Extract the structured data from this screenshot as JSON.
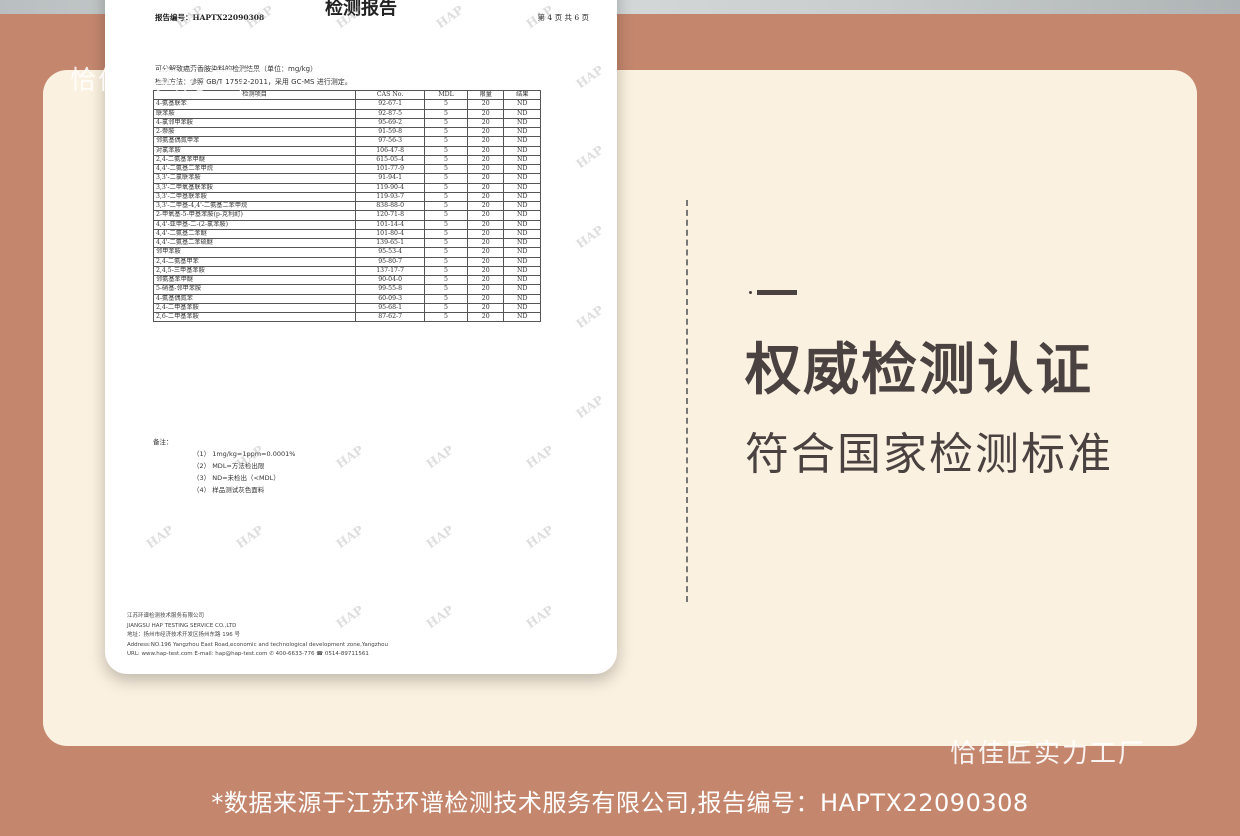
{
  "watermarks": {
    "top_left": "恰佳匠实力工厂",
    "bottom_right": "恰佳匠实力工厂"
  },
  "report": {
    "title": "检测报告",
    "report_no": "报告编号：HAPTX22090308",
    "page": "第 4 页 共 6 页",
    "subtitle1": "可分解致癌芳香胺染料的检测结果（单位：mg/kg）",
    "subtitle2": "检测方法：参照 GB/T 17592-2011，采用 GC-MS 进行测定。",
    "headers": [
      "检测项目",
      "CAS No.",
      "MDL",
      "限量",
      "结果"
    ],
    "rows": [
      [
        "4-氨基联苯",
        "92-67-1",
        "5",
        "20",
        "ND"
      ],
      [
        "联苯胺",
        "92-87-5",
        "5",
        "20",
        "ND"
      ],
      [
        "4-氯邻甲苯胺",
        "95-69-2",
        "5",
        "20",
        "ND"
      ],
      [
        "2-萘胺",
        "91-59-8",
        "5",
        "20",
        "ND"
      ],
      [
        "邻氨基偶氮甲苯",
        "97-56-3",
        "5",
        "20",
        "ND"
      ],
      [
        "对氯苯胺",
        "106-47-8",
        "5",
        "20",
        "ND"
      ],
      [
        "2,4-二氨基苯甲醚",
        "615-05-4",
        "5",
        "20",
        "ND"
      ],
      [
        "4,4'-二氨基二苯甲烷",
        "101-77-9",
        "5",
        "20",
        "ND"
      ],
      [
        "3,3'-二氯联苯胺",
        "91-94-1",
        "5",
        "20",
        "ND"
      ],
      [
        "3,3'-二甲氧基联苯胺",
        "119-90-4",
        "5",
        "20",
        "ND"
      ],
      [
        "3,3'-二甲基联苯胺",
        "119-93-7",
        "5",
        "20",
        "ND"
      ],
      [
        "3,3'-二甲基-4,4'-二氨基二苯甲烷",
        "838-88-0",
        "5",
        "20",
        "ND"
      ],
      [
        "2-甲氧基-5-甲基苯胺(p-克利酊)",
        "120-71-8",
        "5",
        "20",
        "ND"
      ],
      [
        "4,4'-亚甲基-二-(2-氯苯胺)",
        "101-14-4",
        "5",
        "20",
        "ND"
      ],
      [
        "4,4'-二氨基二苯醚",
        "101-80-4",
        "5",
        "20",
        "ND"
      ],
      [
        "4,4'-二氨基二苯硫醚",
        "139-65-1",
        "5",
        "20",
        "ND"
      ],
      [
        "邻甲苯胺",
        "95-53-4",
        "5",
        "20",
        "ND"
      ],
      [
        "2,4-二氨基甲苯",
        "95-80-7",
        "5",
        "20",
        "ND"
      ],
      [
        "2,4,5-三甲基苯胺",
        "137-17-7",
        "5",
        "20",
        "ND"
      ],
      [
        "邻氨基苯甲醚",
        "90-04-0",
        "5",
        "20",
        "ND"
      ],
      [
        "5-硝基-邻甲苯胺",
        "99-55-8",
        "5",
        "20",
        "ND"
      ],
      [
        "4-氨基偶氮苯",
        "60-09-3",
        "5",
        "20",
        "ND"
      ],
      [
        "2,4-二甲基苯胺",
        "95-68-1",
        "5",
        "20",
        "ND"
      ],
      [
        "2,6-二甲基苯胺",
        "87-62-7",
        "5",
        "20",
        "ND"
      ]
    ],
    "notes_label": "备注：",
    "notes": [
      "（1） 1mg/kg=1ppm=0.0001%",
      "（2） MDL=方法检出限",
      "（3） ND=未检出（<MDL）",
      "（4） 样品测试灰色面料"
    ],
    "footer": [
      "江苏环谱检测技术服务有限公司",
      "JIANGSU HAP TESTING SERVICE CO.,LTD",
      "地址：扬州市经济技术开发区扬州东路 196 号",
      "Address:NO.196 Yangzhou East Road,economic and technological development zone,Yangzhou",
      "URL: www.hap-test.com        E-mail: hap@hap-test.com        ✆ 400-6633-776    ☎ 0514-89711561"
    ],
    "watermark_text": "HAP"
  },
  "headline": {
    "dash": "—",
    "title": "权威检测认证",
    "subtitle": "符合国家检测标准"
  },
  "source_note": "*数据来源于江苏环谱检测技术服务有限公司,报告编号：HAPTX22090308"
}
